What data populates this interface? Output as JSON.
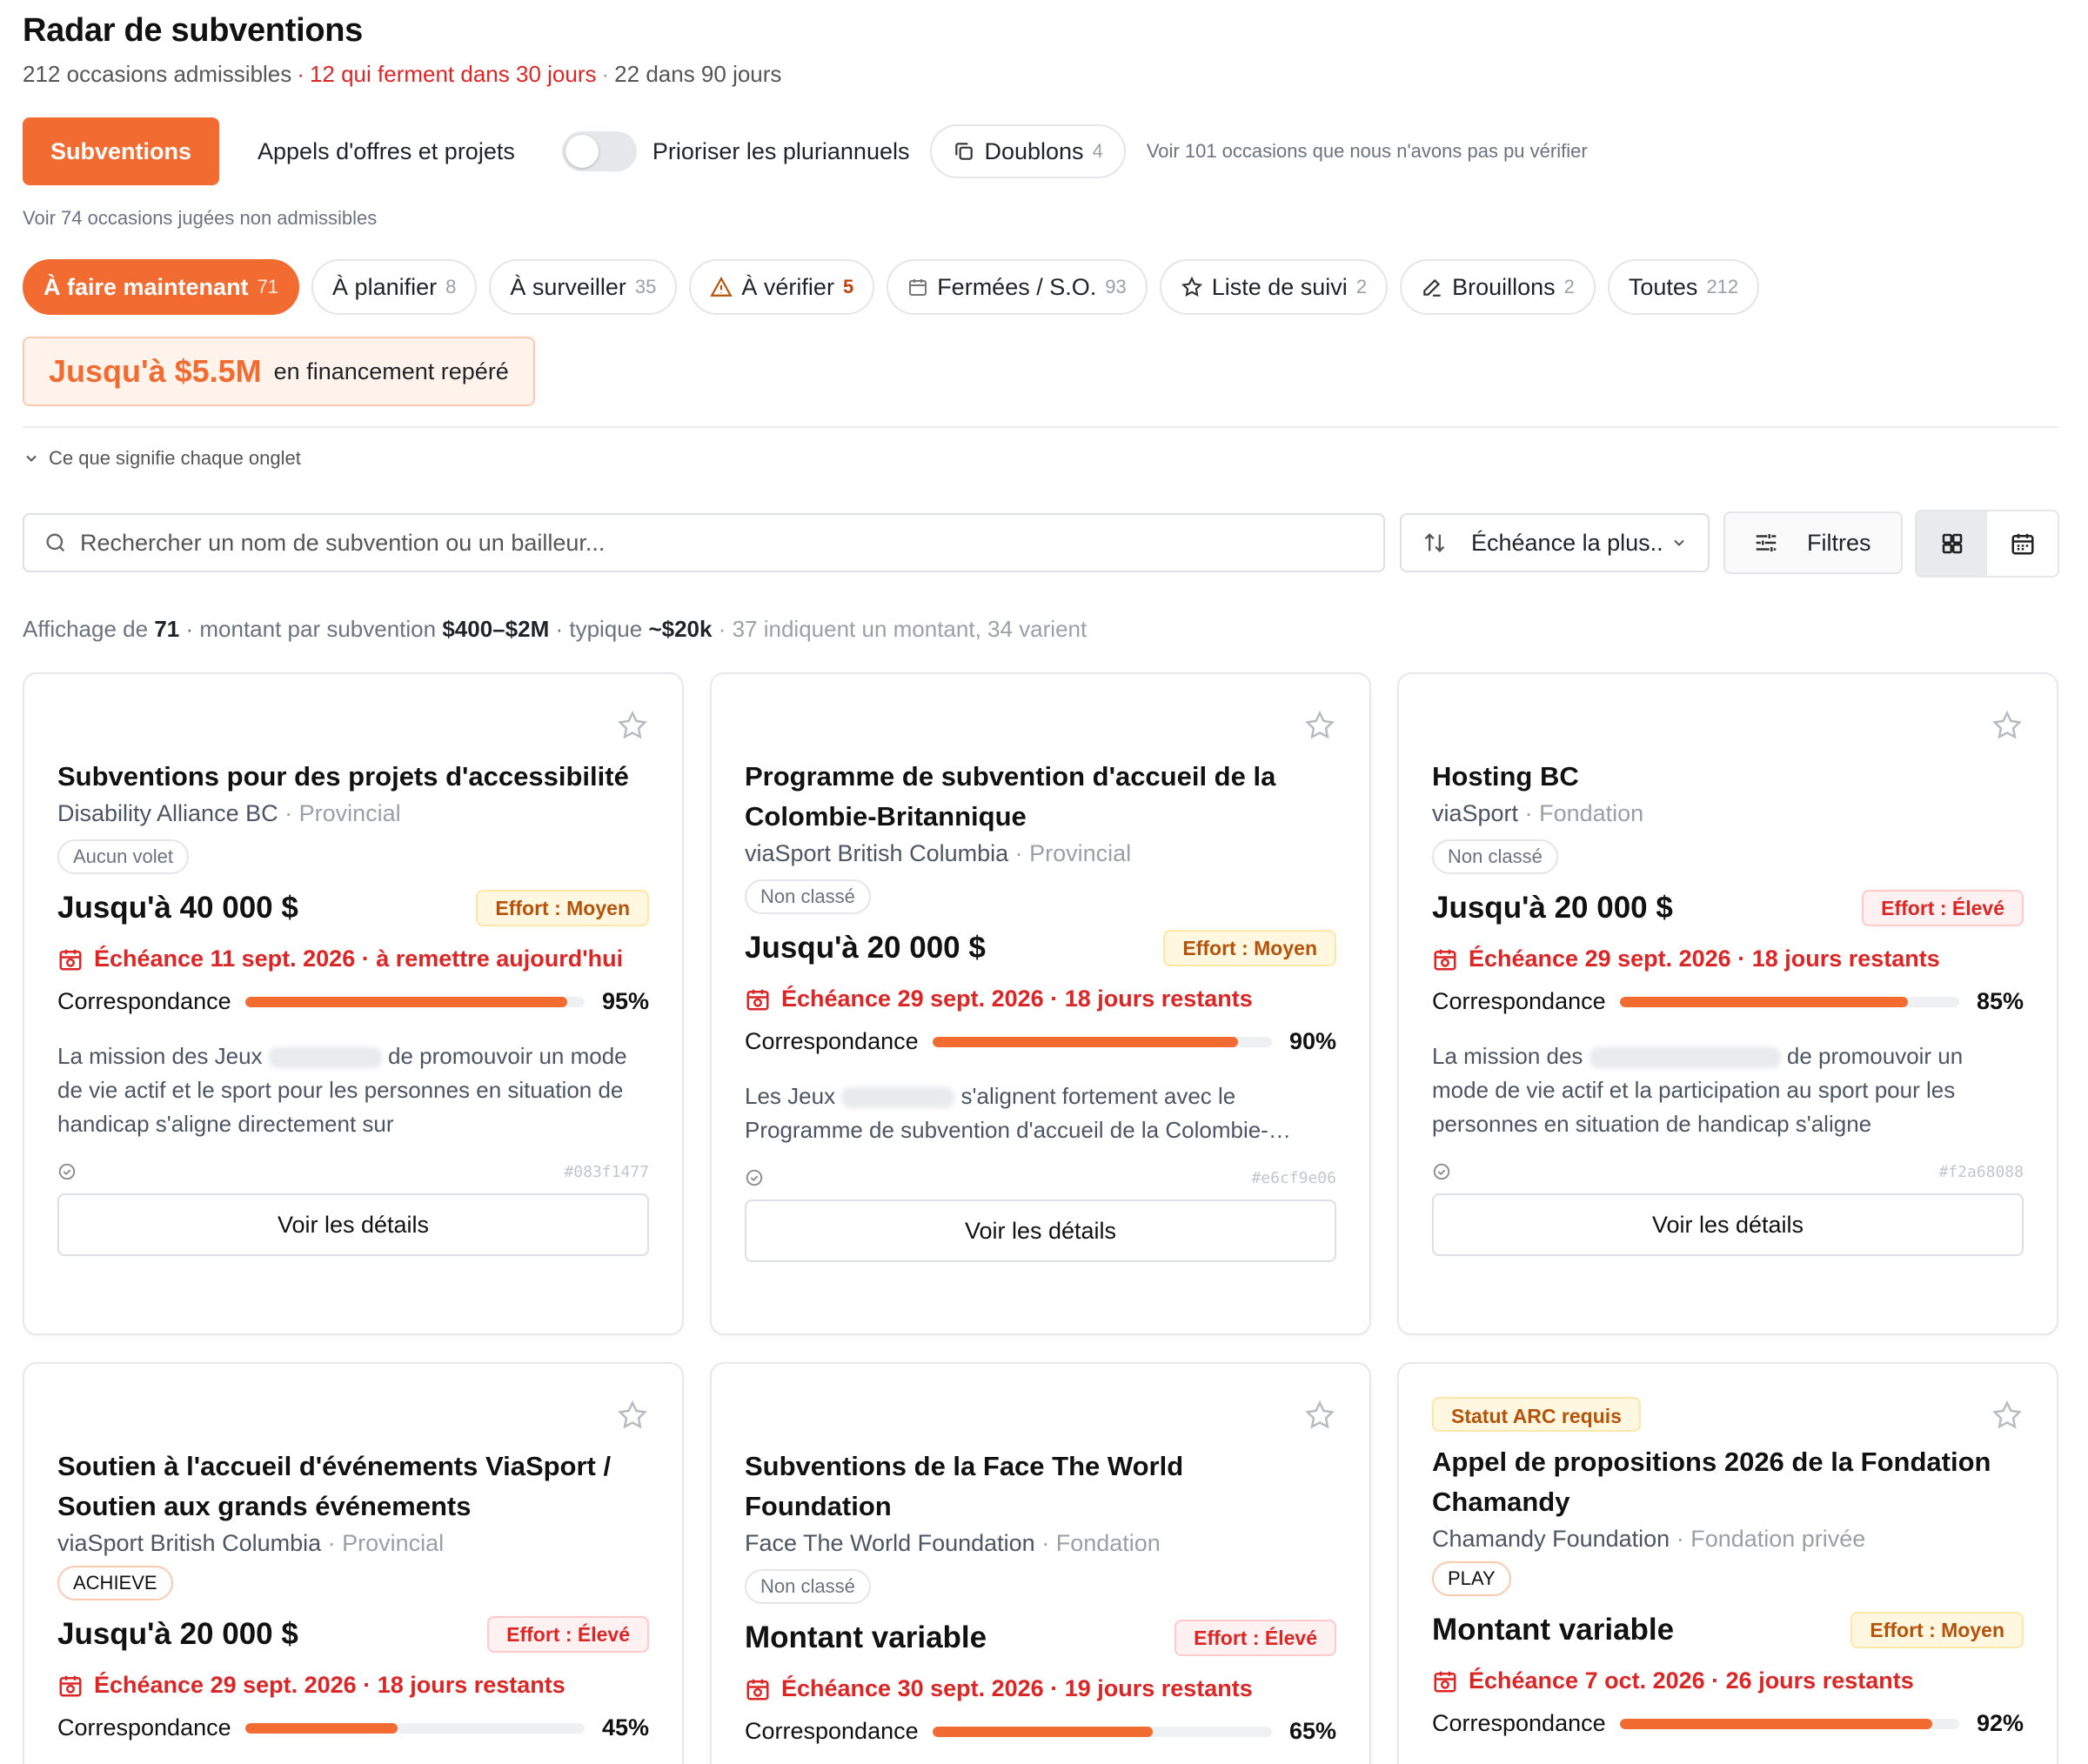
{
  "header": {
    "title": "Radar de subventions",
    "eligible": "212 occasions admissibles",
    "closing": "12 qui ferment dans 30 jours",
    "ninety": "22 dans 90 jours"
  },
  "toolbar": {
    "subventions": "Subventions",
    "appels": "Appels d'offres et projets",
    "toggle_label": "Prioriser les pluriannuels",
    "doublons": "Doublons",
    "doublons_count": "4",
    "unverified": "Voir 101 occasions que nous n'avons pas pu vérifier",
    "non_admissible": "Voir 74 occasions jugées non admissibles"
  },
  "tabs": [
    {
      "label": "À faire maintenant",
      "count": "71"
    },
    {
      "label": "À planifier",
      "count": "8"
    },
    {
      "label": "À surveiller",
      "count": "35"
    },
    {
      "label": "À vérifier",
      "count": "5"
    },
    {
      "label": "Fermées / S.O.",
      "count": "93"
    },
    {
      "label": "Liste de suivi",
      "count": "2"
    },
    {
      "label": "Brouillons",
      "count": "2"
    },
    {
      "label": "Toutes",
      "count": "212"
    }
  ],
  "funding": {
    "amount": "Jusqu'à $5.5M",
    "label": "en financement repéré"
  },
  "meaning": "Ce que signifie chaque onglet",
  "search": {
    "placeholder": "Rechercher un nom de subvention ou un bailleur..."
  },
  "sort": {
    "label": "Échéance la plus.."
  },
  "filters": {
    "label": "Filtres"
  },
  "summary": {
    "prefix": "Affichage de",
    "count": "71",
    "range_label": "· montant par subvention",
    "range": "$400–$2M",
    "typical_label": "· typique",
    "typical": "~$20k",
    "rest": "· 37 indiquent un montant, 34 varient"
  },
  "cards": [
    {
      "title": "Subventions pour des projets d'accessibilité",
      "funder": "Disability Alliance BC",
      "level": "· Provincial",
      "chip": "Aucun volet",
      "amount": "Jusqu'à 40 000 $",
      "effort": "Effort : Moyen",
      "deadline": "Échéance 11 sept. 2026 · à remettre aujourd'hui",
      "match_label": "Correspondance",
      "match": 95,
      "match_text": "95%",
      "desc_a": "La mission des Jeux",
      "desc_b": "de promouvoir un mode de vie actif et le sport pour les personnes en situation de handicap s'aligne directement sur",
      "id": "#083f1477",
      "details": "Voir les détails"
    },
    {
      "title": "Programme de subvention d'accueil de la Colombie-Britannique",
      "funder": "viaSport British Columbia",
      "level": "· Provincial",
      "chip": "Non classé",
      "amount": "Jusqu'à 20 000 $",
      "effort": "Effort : Moyen",
      "deadline": "Échéance 29 sept. 2026 · 18 jours restants",
      "match_label": "Correspondance",
      "match": 90,
      "match_text": "90%",
      "desc_a": "Les Jeux",
      "desc_b": "s'alignent fortement avec le Programme de subvention d'accueil de la Colombie-…",
      "id": "#e6cf9e06",
      "details": "Voir les détails"
    },
    {
      "title": "Hosting BC",
      "funder": "viaSport",
      "level": "· Fondation",
      "chip": "Non classé",
      "amount": "Jusqu'à 20 000 $",
      "effort": "Effort : Élevé",
      "deadline": "Échéance 29 sept. 2026 · 18 jours restants",
      "match_label": "Correspondance",
      "match": 85,
      "match_text": "85%",
      "desc_a": "La mission des",
      "desc_b": "de promouvoir un mode de vie actif et la participation au sport pour les personnes en situation de handicap s'aligne",
      "id": "#f2a68088",
      "details": "Voir les détails"
    },
    {
      "title": "Soutien à l'accueil d'événements ViaSport / Soutien aux grands événements",
      "funder": "viaSport British Columbia",
      "level": "· Provincial",
      "chip": "ACHIEVE",
      "amount": "Jusqu'à 20 000 $",
      "effort": "Effort : Élevé",
      "deadline": "Échéance 29 sept. 2026 · 18 jours restants",
      "match_label": "Correspondance",
      "match": 45,
      "match_text": "45%"
    },
    {
      "title": "Subventions de la Face The World Foundation",
      "funder": "Face The World Foundation",
      "level": "· Fondation",
      "chip": "Non classé",
      "amount": "Montant variable",
      "effort": "Effort : Élevé",
      "deadline": "Échéance 30 sept. 2026 · 19 jours restants",
      "match_label": "Correspondance",
      "match": 65,
      "match_text": "65%"
    },
    {
      "badge": "Statut ARC requis",
      "title": "Appel de propositions 2026 de la Fondation Chamandy",
      "funder": "Chamandy Foundation",
      "level": "· Fondation privée",
      "chip": "PLAY",
      "amount": "Montant variable",
      "effort": "Effort : Moyen",
      "deadline": "Échéance 7 oct. 2026 · 26 jours restants",
      "match_label": "Correspondance",
      "match": 92,
      "match_text": "92%"
    }
  ]
}
